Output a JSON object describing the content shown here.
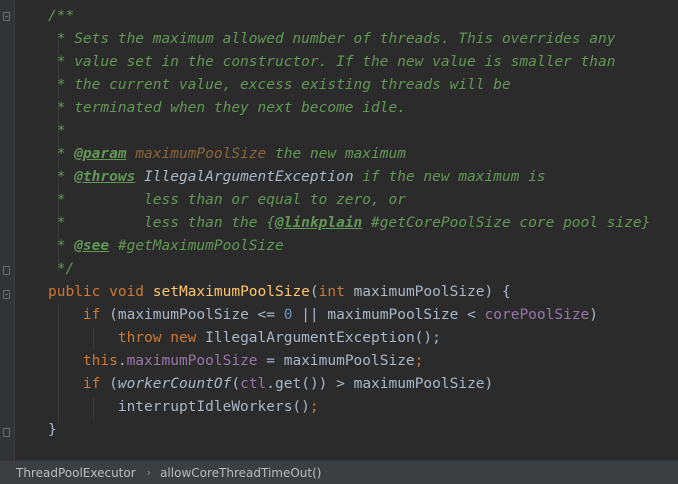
{
  "code": {
    "lines": [
      [
        {
          "text": "/**",
          "cls": "cm"
        }
      ],
      [
        {
          "text": " * Sets the maximum allowed number of threads. This overrides any",
          "cls": "cm"
        }
      ],
      [
        {
          "text": " * value set in the constructor. If the new value is smaller than",
          "cls": "cm"
        }
      ],
      [
        {
          "text": " * the current value, excess existing threads will be",
          "cls": "cm"
        }
      ],
      [
        {
          "text": " * terminated when they next become idle.",
          "cls": "cm"
        }
      ],
      [
        {
          "text": " *",
          "cls": "cm"
        }
      ],
      [
        {
          "text": " * ",
          "cls": "cm"
        },
        {
          "text": "@param",
          "cls": "tag"
        },
        {
          "text": " ",
          "cls": "cm"
        },
        {
          "text": "maximumPoolSize",
          "cls": "pref"
        },
        {
          "text": " the new maximum",
          "cls": "cm"
        }
      ],
      [
        {
          "text": " * ",
          "cls": "cm"
        },
        {
          "text": "@throws",
          "cls": "tag"
        },
        {
          "text": " ",
          "cls": "cm"
        },
        {
          "text": "IllegalArgumentException",
          "cls": "ref"
        },
        {
          "text": " if the new maximum is",
          "cls": "cm"
        }
      ],
      [
        {
          "text": " *         less than or equal to zero, or",
          "cls": "cm"
        }
      ],
      [
        {
          "text": " *         less than the {",
          "cls": "cm"
        },
        {
          "text": "@linkplain",
          "cls": "tag"
        },
        {
          "text": " #getCorePoolSize core pool size}",
          "cls": "cm"
        }
      ],
      [
        {
          "text": " * ",
          "cls": "cm"
        },
        {
          "text": "@see",
          "cls": "tag"
        },
        {
          "text": " #getMaximumPoolSize",
          "cls": "cm"
        }
      ],
      [
        {
          "text": " */",
          "cls": "cm"
        }
      ],
      [
        {
          "text": "public void ",
          "cls": "kw"
        },
        {
          "text": "setMaximumPoolSize",
          "cls": "fn"
        },
        {
          "text": "(",
          "cls": "tx"
        },
        {
          "text": "int ",
          "cls": "kw"
        },
        {
          "text": "maximumPoolSize) {",
          "cls": "tx"
        }
      ],
      [
        {
          "text": "    ",
          "cls": "tx"
        },
        {
          "text": "if ",
          "cls": "kw"
        },
        {
          "text": "(maximumPoolSize <= ",
          "cls": "tx"
        },
        {
          "text": "0",
          "cls": "num"
        },
        {
          "text": " || maximumPoolSize < ",
          "cls": "tx"
        },
        {
          "text": "corePoolSize",
          "cls": "fld"
        },
        {
          "text": ")",
          "cls": "tx"
        }
      ],
      [
        {
          "text": "        ",
          "cls": "tx"
        },
        {
          "text": "throw new ",
          "cls": "kw"
        },
        {
          "text": "IllegalArgumentException();",
          "cls": "tx"
        }
      ],
      [
        {
          "text": "    ",
          "cls": "tx"
        },
        {
          "text": "this",
          "cls": "kw"
        },
        {
          "text": ".",
          "cls": "tx"
        },
        {
          "text": "maximumPoolSize",
          "cls": "fld"
        },
        {
          "text": " = maximumPoolSize",
          "cls": "tx"
        },
        {
          "text": ";",
          "cls": "kw"
        }
      ],
      [
        {
          "text": "    ",
          "cls": "tx"
        },
        {
          "text": "if ",
          "cls": "kw"
        },
        {
          "text": "(",
          "cls": "tx"
        },
        {
          "text": "workerCountOf",
          "cls": "itl"
        },
        {
          "text": "(",
          "cls": "tx"
        },
        {
          "text": "ctl",
          "cls": "fld"
        },
        {
          "text": ".get()) > maximumPoolSize)",
          "cls": "tx"
        }
      ],
      [
        {
          "text": "        interruptIdleWorkers()",
          "cls": "tx"
        },
        {
          "text": ";",
          "cls": "kw"
        }
      ],
      [
        {
          "text": "}",
          "cls": "tx"
        }
      ]
    ]
  },
  "breadcrumb": {
    "items": [
      "ThreadPoolExecutor",
      "allowCoreThreadTimeOut()"
    ],
    "separator": "›"
  }
}
